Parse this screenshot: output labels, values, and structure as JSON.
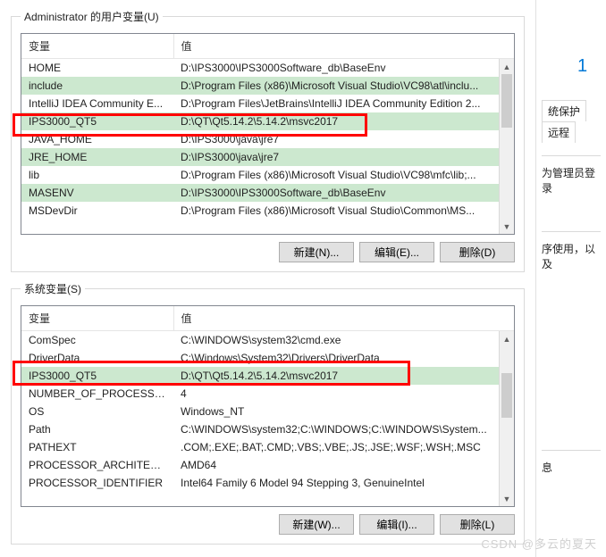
{
  "user_section": {
    "legend": "Administrator 的用户变量(U)",
    "headers": {
      "name": "变量",
      "value": "值"
    },
    "rows": [
      {
        "name": "HOME",
        "value": "D:\\IPS3000\\IPS3000Software_db\\BaseEnv",
        "hl": false
      },
      {
        "name": "include",
        "value": "D:\\Program Files (x86)\\Microsoft Visual Studio\\VC98\\atl\\inclu...",
        "hl": true
      },
      {
        "name": "IntelliJ IDEA Community E...",
        "value": "D:\\Program Files\\JetBrains\\IntelliJ IDEA Community Edition 2...",
        "hl": false
      },
      {
        "name": "IPS3000_QT5",
        "value": "D:\\QT\\Qt5.14.2\\5.14.2\\msvc2017",
        "hl": true
      },
      {
        "name": "JAVA_HOME",
        "value": "D:\\IPS3000\\java\\jre7",
        "hl": false
      },
      {
        "name": "JRE_HOME",
        "value": "D:\\IPS3000\\java\\jre7",
        "hl": true
      },
      {
        "name": "lib",
        "value": "D:\\Program Files (x86)\\Microsoft Visual Studio\\VC98\\mfc\\lib;...",
        "hl": false
      },
      {
        "name": "MASENV",
        "value": "D:\\IPS3000\\IPS3000Software_db\\BaseEnv",
        "hl": true
      },
      {
        "name": "MSDevDir",
        "value": "D:\\Program Files (x86)\\Microsoft Visual Studio\\Common\\MS...",
        "hl": false
      }
    ],
    "buttons": {
      "new": "新建(N)...",
      "edit": "编辑(E)...",
      "delete": "删除(D)"
    }
  },
  "system_section": {
    "legend": "系统变量(S)",
    "headers": {
      "name": "变量",
      "value": "值"
    },
    "rows": [
      {
        "name": "ComSpec",
        "value": "C:\\WINDOWS\\system32\\cmd.exe",
        "hl": false
      },
      {
        "name": "DriverData",
        "value": "C:\\Windows\\System32\\Drivers\\DriverData",
        "hl": false
      },
      {
        "name": "IPS3000_QT5",
        "value": "D:\\QT\\Qt5.14.2\\5.14.2\\msvc2017",
        "hl": true
      },
      {
        "name": "NUMBER_OF_PROCESSORS",
        "value": "4",
        "hl": false
      },
      {
        "name": "OS",
        "value": "Windows_NT",
        "hl": false
      },
      {
        "name": "Path",
        "value": "C:\\WINDOWS\\system32;C:\\WINDOWS;C:\\WINDOWS\\System...",
        "hl": false
      },
      {
        "name": "PATHEXT",
        "value": ".COM;.EXE;.BAT;.CMD;.VBS;.VBE;.JS;.JSE;.WSF;.WSH;.MSC",
        "hl": false
      },
      {
        "name": "PROCESSOR_ARCHITECTU...",
        "value": "AMD64",
        "hl": false
      },
      {
        "name": "PROCESSOR_IDENTIFIER",
        "value": "Intel64 Family 6 Model 94 Stepping 3, GenuineIntel",
        "hl": false
      }
    ],
    "buttons": {
      "new": "新建(W)...",
      "edit": "编辑(I)...",
      "delete": "删除(L)"
    }
  },
  "right": {
    "num": "1",
    "tab1": "统保护",
    "tab2": "远程",
    "frag1": "为管理员登录",
    "frag2": "序使用，以及",
    "frag3": "息"
  },
  "watermark": "CSDN @多云的夏天"
}
